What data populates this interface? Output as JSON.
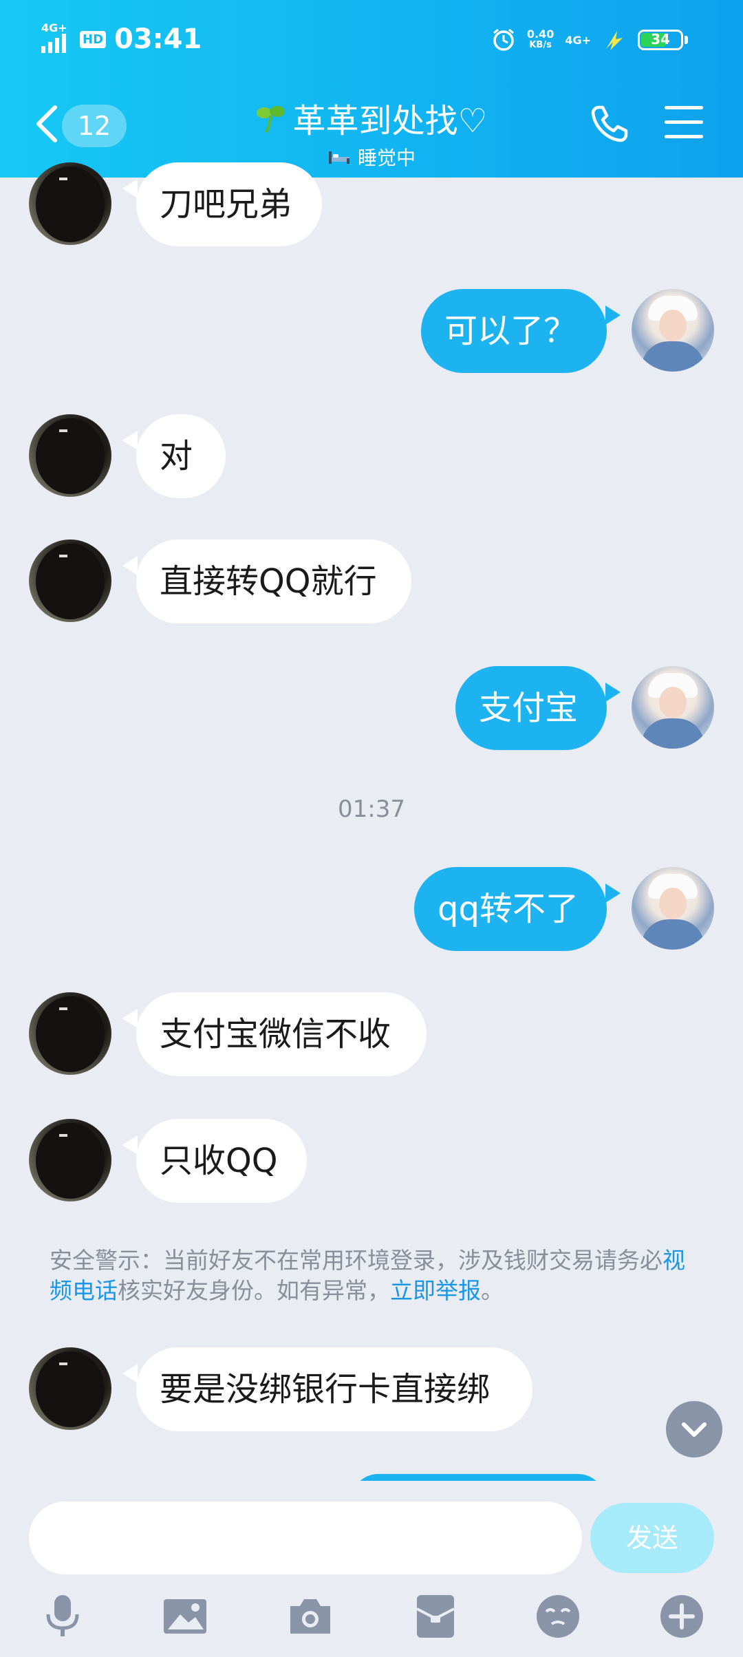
{
  "status_bar": {
    "network_label": "4G+",
    "hd_label": "HD",
    "time": "03:41",
    "speed_value": "0.40",
    "speed_unit": "KB/s",
    "network_label_2": "4G+",
    "battery": "34"
  },
  "header": {
    "unread_count": "12",
    "contact_name": "革革到处找♡",
    "status_text": "睡觉中"
  },
  "messages": [
    {
      "side": "in",
      "text": "刀吧兄弟"
    },
    {
      "side": "out",
      "text": "可以了？"
    },
    {
      "side": "in",
      "text": "对"
    },
    {
      "side": "in",
      "text": "直接转QQ就行"
    },
    {
      "side": "out",
      "text": "支付宝"
    },
    {
      "side": "out",
      "text": "qq转不了"
    },
    {
      "side": "in",
      "text": "支付宝微信不收"
    },
    {
      "side": "in",
      "text": "只收QQ"
    },
    {
      "side": "in",
      "text": "要是没绑银行卡直接绑"
    }
  ],
  "timestamp": "01:37",
  "warning": {
    "part1": "安全警示：当前好友不在常用环境登录，涉及钱财交易请务必",
    "link1": "视频电话",
    "part2": "核实好友身份。如有异常，",
    "link2": "立即举报",
    "part3": "。"
  },
  "input": {
    "placeholder": "",
    "send_label": "发送"
  },
  "toolbar_icons": [
    "microphone-icon",
    "image-icon",
    "camera-icon",
    "red-packet-icon",
    "emoji-icon",
    "plus-icon"
  ],
  "colors": {
    "header": "#11b4f2",
    "outgoing_bubble": "#1cb3f0",
    "incoming_bubble": "#ffffff",
    "link": "#1996e6",
    "background": "#eaecf3"
  }
}
